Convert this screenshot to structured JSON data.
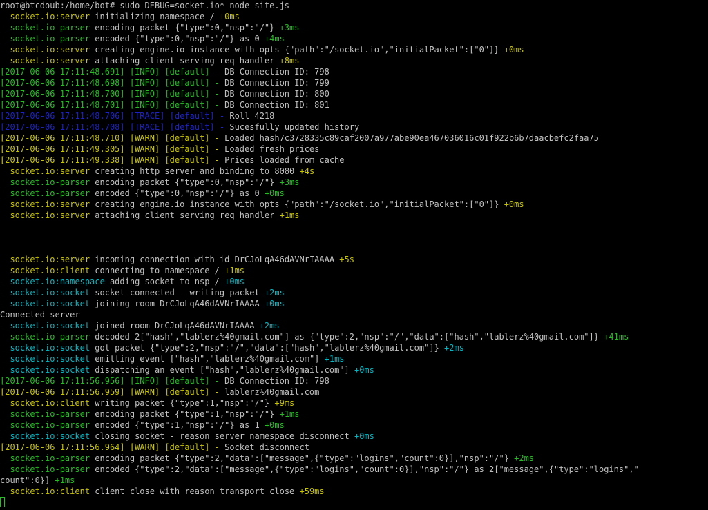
{
  "colors": {
    "background": "#000000",
    "default_text": "#c0c0c0",
    "yellow": "#c7c400",
    "green": "#25bc24",
    "blue": "#1c22c6",
    "cyan": "#00b8c4"
  },
  "terminal": {
    "lines": [
      {
        "segments": [
          {
            "text": "root@btcdoub:/home/bot# sudo DEBUG=socket.io* node site.js",
            "color": "white"
          }
        ]
      },
      {
        "segments": [
          {
            "text": "  socket.io:server ",
            "color": "yellow"
          },
          {
            "text": "initializing namespace / ",
            "color": "white"
          },
          {
            "text": "+0ms",
            "color": "yellow"
          }
        ]
      },
      {
        "segments": [
          {
            "text": "  socket.io-parser ",
            "color": "green"
          },
          {
            "text": "encoding packet {\"type\":0,\"nsp\":\"/\"} ",
            "color": "white"
          },
          {
            "text": "+3ms",
            "color": "green"
          }
        ]
      },
      {
        "segments": [
          {
            "text": "  socket.io-parser ",
            "color": "green"
          },
          {
            "text": "encoded {\"type\":0,\"nsp\":\"/\"} as 0 ",
            "color": "white"
          },
          {
            "text": "+4ms",
            "color": "green"
          }
        ]
      },
      {
        "segments": [
          {
            "text": "  socket.io:server ",
            "color": "yellow"
          },
          {
            "text": "creating engine.io instance with opts {\"path\":\"/socket.io\",\"initialPacket\":[\"0\"]} ",
            "color": "white"
          },
          {
            "text": "+0ms",
            "color": "yellow"
          }
        ]
      },
      {
        "segments": [
          {
            "text": "  socket.io:server ",
            "color": "yellow"
          },
          {
            "text": "attaching client serving req handler ",
            "color": "white"
          },
          {
            "text": "+8ms",
            "color": "yellow"
          }
        ]
      },
      {
        "segments": [
          {
            "text": "[2017-06-06 17:11:48.691] [INFO] [default] - ",
            "color": "green"
          },
          {
            "text": "DB Connection ID: 798",
            "color": "white"
          }
        ]
      },
      {
        "segments": [
          {
            "text": "[2017-06-06 17:11:48.698] [INFO] [default] - ",
            "color": "green"
          },
          {
            "text": "DB Connection ID: 799",
            "color": "white"
          }
        ]
      },
      {
        "segments": [
          {
            "text": "[2017-06-06 17:11:48.700] [INFO] [default] - ",
            "color": "green"
          },
          {
            "text": "DB Connection ID: 800",
            "color": "white"
          }
        ]
      },
      {
        "segments": [
          {
            "text": "[2017-06-06 17:11:48.701] [INFO] [default] - ",
            "color": "green"
          },
          {
            "text": "DB Connection ID: 801",
            "color": "white"
          }
        ]
      },
      {
        "segments": [
          {
            "text": "[2017-06-06 17:11:48.706] [TRACE] [default] - ",
            "color": "blue"
          },
          {
            "text": "Roll 4218",
            "color": "white"
          }
        ]
      },
      {
        "segments": [
          {
            "text": "[2017-06-06 17:11:48.708] [TRACE] [default] - ",
            "color": "blue"
          },
          {
            "text": "Sucesfully updated history",
            "color": "white"
          }
        ]
      },
      {
        "segments": [
          {
            "text": "[2017-06-06 17:11:48.710] [WARN] [default] - ",
            "color": "yellow"
          },
          {
            "text": "Loaded hash7c3728335c89caf2007a977abe90ea467036016c01f922b6b7daacbefc2faa75",
            "color": "white"
          }
        ]
      },
      {
        "segments": [
          {
            "text": "[2017-06-06 17:11:49.305] [WARN] [default] - ",
            "color": "yellow"
          },
          {
            "text": "Loaded fresh prices",
            "color": "white"
          }
        ]
      },
      {
        "segments": [
          {
            "text": "[2017-06-06 17:11:49.338] [WARN] [default] - ",
            "color": "yellow"
          },
          {
            "text": "Prices loaded from cache",
            "color": "white"
          }
        ]
      },
      {
        "segments": [
          {
            "text": "  socket.io:server ",
            "color": "yellow"
          },
          {
            "text": "creating http server and binding to 8080 ",
            "color": "white"
          },
          {
            "text": "+4s",
            "color": "yellow"
          }
        ]
      },
      {
        "segments": [
          {
            "text": "  socket.io-parser ",
            "color": "green"
          },
          {
            "text": "encoding packet {\"type\":0,\"nsp\":\"/\"} ",
            "color": "white"
          },
          {
            "text": "+3ms",
            "color": "green"
          }
        ]
      },
      {
        "segments": [
          {
            "text": "  socket.io-parser ",
            "color": "green"
          },
          {
            "text": "encoded {\"type\":0,\"nsp\":\"/\"} as 0 ",
            "color": "white"
          },
          {
            "text": "+0ms",
            "color": "green"
          }
        ]
      },
      {
        "segments": [
          {
            "text": "  socket.io:server ",
            "color": "yellow"
          },
          {
            "text": "creating engine.io instance with opts {\"path\":\"/socket.io\",\"initialPacket\":[\"0\"]} ",
            "color": "white"
          },
          {
            "text": "+0ms",
            "color": "yellow"
          }
        ]
      },
      {
        "segments": [
          {
            "text": "  socket.io:server ",
            "color": "yellow"
          },
          {
            "text": "attaching client serving req handler ",
            "color": "white"
          },
          {
            "text": "+1ms",
            "color": "yellow"
          }
        ]
      },
      {
        "segments": []
      },
      {
        "segments": []
      },
      {
        "segments": []
      },
      {
        "segments": [
          {
            "text": "  socket.io:server ",
            "color": "yellow"
          },
          {
            "text": "incoming connection with id DrCJoLqA46dAVNrIAAAA ",
            "color": "white"
          },
          {
            "text": "+5s",
            "color": "yellow"
          }
        ]
      },
      {
        "segments": [
          {
            "text": "  socket.io:client ",
            "color": "yellow"
          },
          {
            "text": "connecting to namespace / ",
            "color": "white"
          },
          {
            "text": "+1ms",
            "color": "yellow"
          }
        ]
      },
      {
        "segments": [
          {
            "text": "  socket.io:namespace ",
            "color": "cyan"
          },
          {
            "text": "adding socket to nsp / ",
            "color": "white"
          },
          {
            "text": "+0ms",
            "color": "cyan"
          }
        ]
      },
      {
        "segments": [
          {
            "text": "  socket.io:socket ",
            "color": "cyan"
          },
          {
            "text": "socket connected - writing packet ",
            "color": "white"
          },
          {
            "text": "+2ms",
            "color": "cyan"
          }
        ]
      },
      {
        "segments": [
          {
            "text": "  socket.io:socket ",
            "color": "cyan"
          },
          {
            "text": "joining room DrCJoLqA46dAVNrIAAAA ",
            "color": "white"
          },
          {
            "text": "+0ms",
            "color": "cyan"
          }
        ]
      },
      {
        "segments": [
          {
            "text": "Connected server",
            "color": "white"
          }
        ]
      },
      {
        "segments": [
          {
            "text": "  socket.io:socket ",
            "color": "cyan"
          },
          {
            "text": "joined room DrCJoLqA46dAVNrIAAAA ",
            "color": "white"
          },
          {
            "text": "+2ms",
            "color": "cyan"
          }
        ]
      },
      {
        "segments": [
          {
            "text": "  socket.io-parser ",
            "color": "green"
          },
          {
            "text": "decoded 2[\"hash\",\"lablerz%40gmail.com\"] as {\"type\":2,\"nsp\":\"/\",\"data\":[\"hash\",\"lablerz%40gmail.com\"]} ",
            "color": "white"
          },
          {
            "text": "+41ms",
            "color": "green"
          }
        ]
      },
      {
        "segments": [
          {
            "text": "  socket.io:socket ",
            "color": "cyan"
          },
          {
            "text": "got packet {\"type\":2,\"nsp\":\"/\",\"data\":[\"hash\",\"lablerz%40gmail.com\"]} ",
            "color": "white"
          },
          {
            "text": "+2ms",
            "color": "cyan"
          }
        ]
      },
      {
        "segments": [
          {
            "text": "  socket.io:socket ",
            "color": "cyan"
          },
          {
            "text": "emitting event [\"hash\",\"lablerz%40gmail.com\"] ",
            "color": "white"
          },
          {
            "text": "+1ms",
            "color": "cyan"
          }
        ]
      },
      {
        "segments": [
          {
            "text": "  socket.io:socket ",
            "color": "cyan"
          },
          {
            "text": "dispatching an event [\"hash\",\"lablerz%40gmail.com\"] ",
            "color": "white"
          },
          {
            "text": "+0ms",
            "color": "cyan"
          }
        ]
      },
      {
        "segments": [
          {
            "text": "[2017-06-06 17:11:56.956] [INFO] [default] - ",
            "color": "green"
          },
          {
            "text": "DB Connection ID: 798",
            "color": "white"
          }
        ]
      },
      {
        "segments": [
          {
            "text": "[2017-06-06 17:11:56.959] [WARN] [default] - ",
            "color": "yellow"
          },
          {
            "text": "lablerz%40gmail.com",
            "color": "white"
          }
        ]
      },
      {
        "segments": [
          {
            "text": "  socket.io:client ",
            "color": "yellow"
          },
          {
            "text": "writing packet {\"type\":1,\"nsp\":\"/\"} ",
            "color": "white"
          },
          {
            "text": "+9ms",
            "color": "yellow"
          }
        ]
      },
      {
        "segments": [
          {
            "text": "  socket.io-parser ",
            "color": "green"
          },
          {
            "text": "encoding packet {\"type\":1,\"nsp\":\"/\"} ",
            "color": "white"
          },
          {
            "text": "+1ms",
            "color": "green"
          }
        ]
      },
      {
        "segments": [
          {
            "text": "  socket.io-parser ",
            "color": "green"
          },
          {
            "text": "encoded {\"type\":1,\"nsp\":\"/\"} as 1 ",
            "color": "white"
          },
          {
            "text": "+0ms",
            "color": "green"
          }
        ]
      },
      {
        "segments": [
          {
            "text": "  socket.io:socket ",
            "color": "cyan"
          },
          {
            "text": "closing socket - reason server namespace disconnect ",
            "color": "white"
          },
          {
            "text": "+0ms",
            "color": "cyan"
          }
        ]
      },
      {
        "segments": [
          {
            "text": "[2017-06-06 17:11:56.964] [WARN] [default] - ",
            "color": "yellow"
          },
          {
            "text": "Socket disconnect",
            "color": "white"
          }
        ]
      },
      {
        "segments": [
          {
            "text": "  socket.io-parser ",
            "color": "green"
          },
          {
            "text": "encoding packet {\"type\":2,\"data\":[\"message\",{\"type\":\"logins\",\"count\":0}],\"nsp\":\"/\"} ",
            "color": "white"
          },
          {
            "text": "+2ms",
            "color": "green"
          }
        ]
      },
      {
        "segments": [
          {
            "text": "  socket.io-parser ",
            "color": "green"
          },
          {
            "text": "encoded {\"type\":2,\"data\":[\"message\",{\"type\":\"logins\",\"count\":0}],\"nsp\":\"/\"} as 2[\"message\",{\"type\":\"logins\",\"",
            "color": "white"
          }
        ]
      },
      {
        "segments": [
          {
            "text": "count\":0}] ",
            "color": "white"
          },
          {
            "text": "+1ms",
            "color": "green"
          }
        ]
      },
      {
        "segments": [
          {
            "text": "  socket.io:client ",
            "color": "yellow"
          },
          {
            "text": "client close with reason transport close ",
            "color": "white"
          },
          {
            "text": "+59ms",
            "color": "yellow"
          }
        ]
      }
    ]
  }
}
